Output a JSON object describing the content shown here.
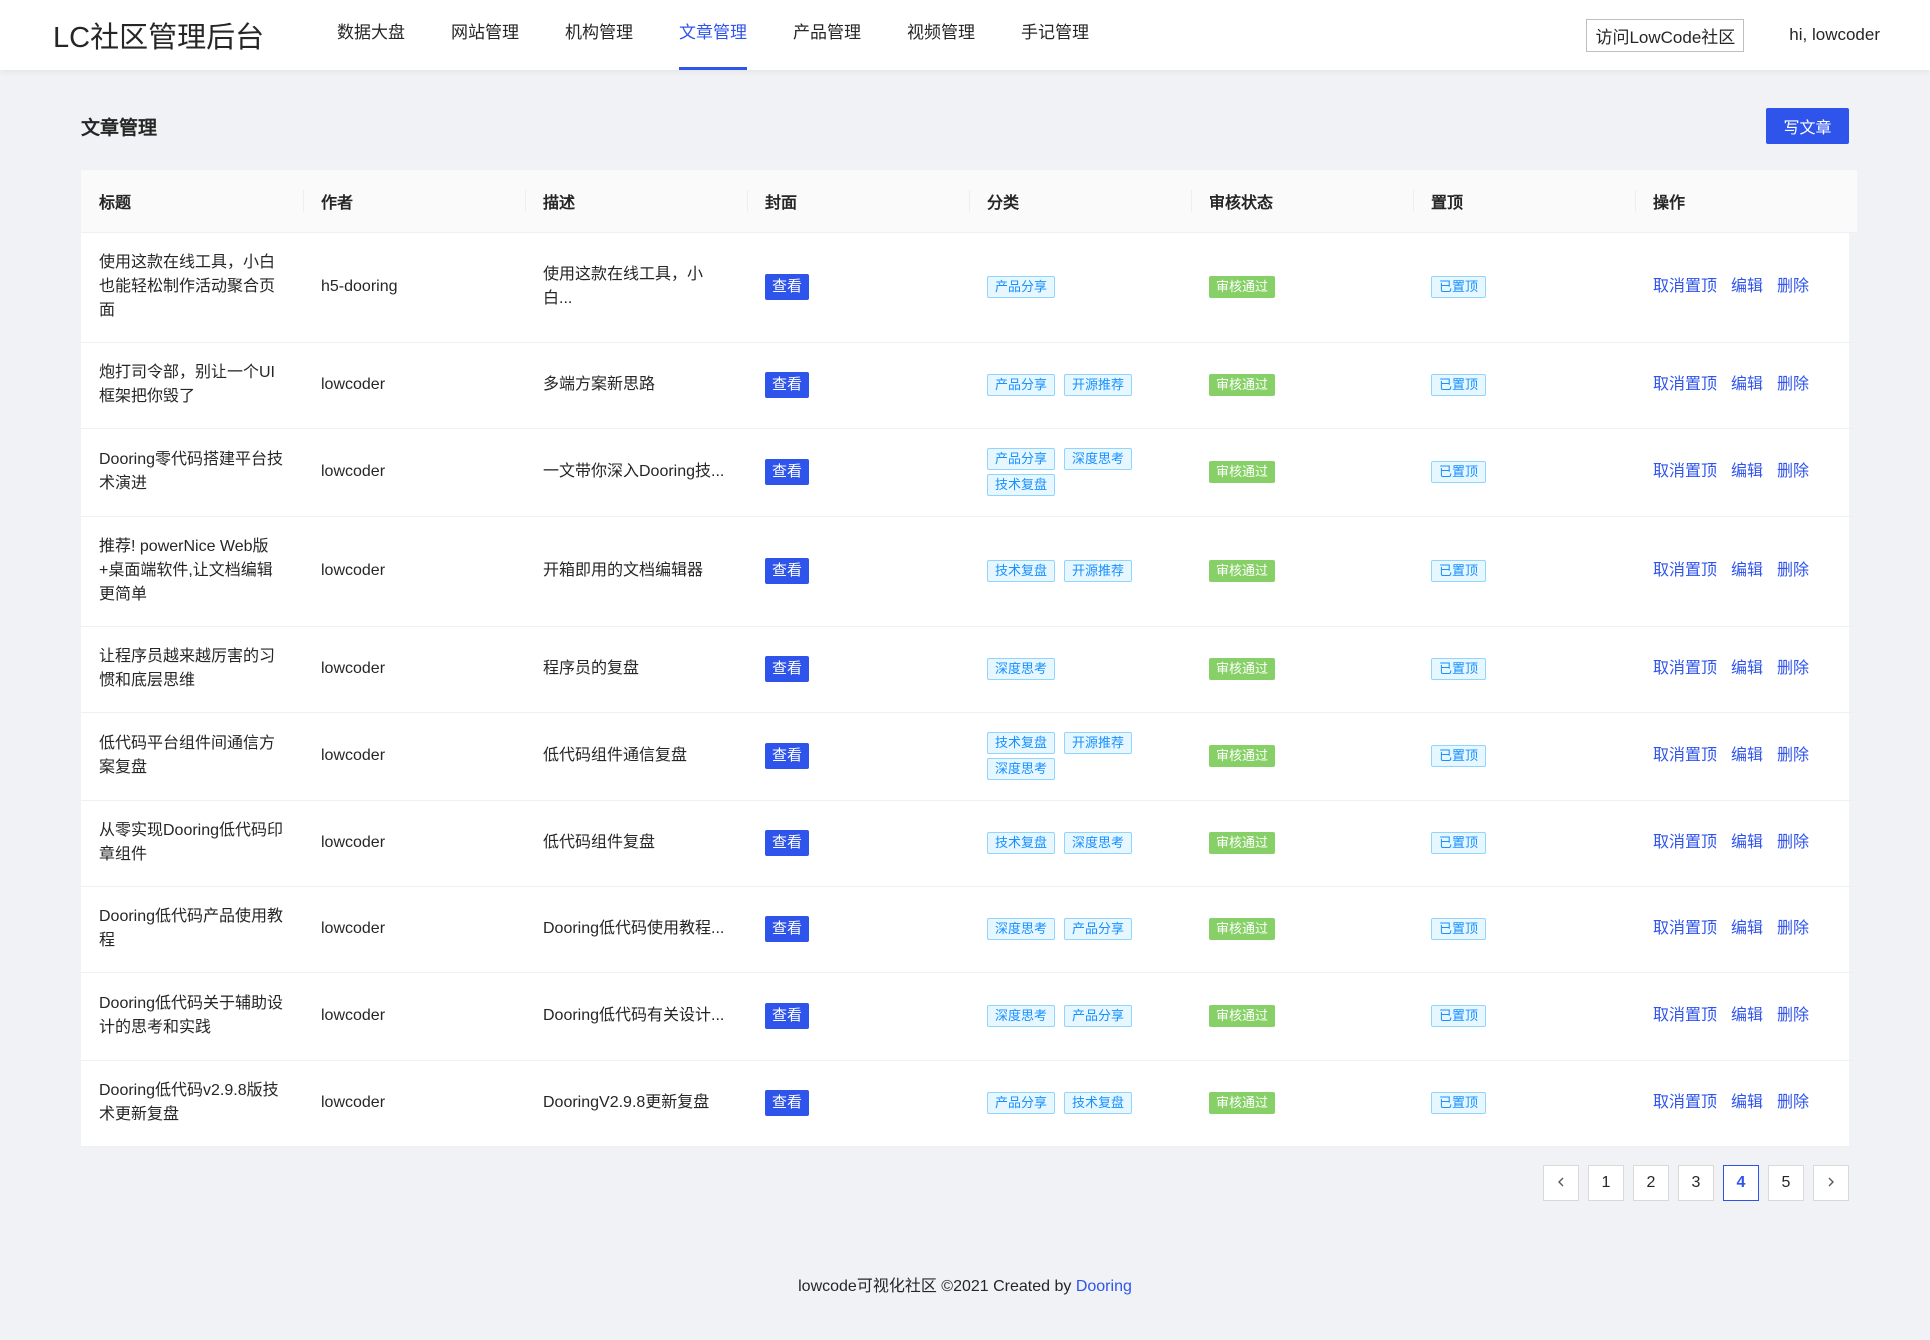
{
  "header": {
    "logo": "LC社区管理后台",
    "nav": [
      {
        "label": "数据大盘",
        "active": false
      },
      {
        "label": "网站管理",
        "active": false
      },
      {
        "label": "机构管理",
        "active": false
      },
      {
        "label": "文章管理",
        "active": true
      },
      {
        "label": "产品管理",
        "active": false
      },
      {
        "label": "视频管理",
        "active": false
      },
      {
        "label": "手记管理",
        "active": false
      }
    ],
    "visit_label": "访问LowCode社区",
    "greeting": "hi, lowcoder"
  },
  "page": {
    "title": "文章管理",
    "write_label": "写文章"
  },
  "table": {
    "columns": [
      "标题",
      "作者",
      "描述",
      "封面",
      "分类",
      "审核状态",
      "置顶",
      "操作"
    ],
    "view_label": "查看",
    "actions": {
      "unpin": "取消置顶",
      "edit": "编辑",
      "delete": "删除"
    },
    "rows": [
      {
        "title": "使用这款在线工具，小白也能轻松制作活动聚合页面",
        "author": "h5-dooring",
        "desc": "使用这款在线工具，小白...",
        "tags": [
          "产品分享"
        ],
        "status": "审核通过",
        "pin": "已置顶"
      },
      {
        "title": "炮打司令部，别让一个UI框架把你毁了",
        "author": "lowcoder",
        "desc": "多端方案新思路",
        "tags": [
          "产品分享",
          "开源推荐"
        ],
        "status": "审核通过",
        "pin": "已置顶"
      },
      {
        "title": "Dooring零代码搭建平台技术演进",
        "author": "lowcoder",
        "desc": "一文带你深入Dooring技...",
        "tags": [
          "产品分享",
          "深度思考",
          "技术复盘"
        ],
        "status": "审核通过",
        "pin": "已置顶"
      },
      {
        "title": "推荐! powerNice Web版+桌面端软件,让文档编辑更简单",
        "author": "lowcoder",
        "desc": "开箱即用的文档编辑器",
        "tags": [
          "技术复盘",
          "开源推荐"
        ],
        "status": "审核通过",
        "pin": "已置顶"
      },
      {
        "title": "让程序员越来越厉害的习惯和底层思维",
        "author": "lowcoder",
        "desc": "程序员的复盘",
        "tags": [
          "深度思考"
        ],
        "status": "审核通过",
        "pin": "已置顶"
      },
      {
        "title": "低代码平台组件间通信方案复盘",
        "author": "lowcoder",
        "desc": "低代码组件通信复盘",
        "tags": [
          "技术复盘",
          "开源推荐",
          "深度思考"
        ],
        "status": "审核通过",
        "pin": "已置顶"
      },
      {
        "title": "从零实现Dooring低代码印章组件",
        "author": "lowcoder",
        "desc": "低代码组件复盘",
        "tags": [
          "技术复盘",
          "深度思考"
        ],
        "status": "审核通过",
        "pin": "已置顶"
      },
      {
        "title": "Dooring低代码产品使用教程",
        "author": "lowcoder",
        "desc": "Dooring低代码使用教程...",
        "tags": [
          "深度思考",
          "产品分享"
        ],
        "status": "审核通过",
        "pin": "已置顶"
      },
      {
        "title": "Dooring低代码关于辅助设计的思考和实践",
        "author": "lowcoder",
        "desc": "Dooring低代码有关设计...",
        "tags": [
          "深度思考",
          "产品分享"
        ],
        "status": "审核通过",
        "pin": "已置顶"
      },
      {
        "title": "Dooring低代码v2.9.8版技术更新复盘",
        "author": "lowcoder",
        "desc": "DooringV2.9.8更新复盘",
        "tags": [
          "产品分享",
          "技术复盘"
        ],
        "status": "审核通过",
        "pin": "已置顶"
      }
    ]
  },
  "pagination": {
    "pages": [
      "1",
      "2",
      "3",
      "4",
      "5"
    ],
    "current": "4",
    "prev_icon": "chevron-left-icon",
    "next_icon": "chevron-right-icon"
  },
  "footer": {
    "text": "lowcode可视化社区 ©2021 Created by ",
    "link": "Dooring"
  },
  "colors": {
    "primary": "#2f54eb",
    "status_green": "#87d068",
    "tag_blue": "#1890ff",
    "background": "#f0f2f5"
  }
}
